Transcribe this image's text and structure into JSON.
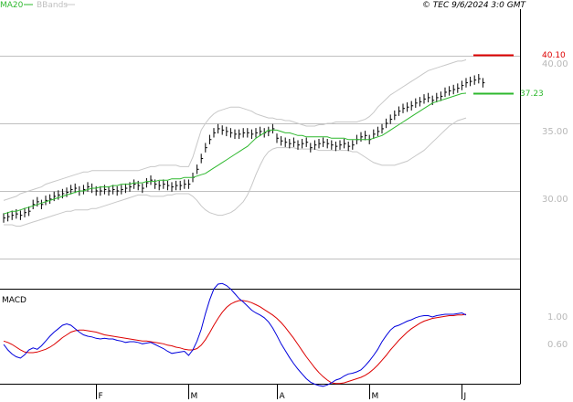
{
  "header": {
    "legend_ma": "MA20",
    "legend_bb": "BBands",
    "stamp": "© TEC 9/6/2024 3:0 GMT"
  },
  "price_labels": {
    "resistance": "40.10",
    "ma_value": "37.23"
  },
  "macd_label": "MACD",
  "colors": {
    "ma": "#2eb82e",
    "bands": "#c8c8c8",
    "resistance": "#dd0000",
    "macd": "#0000dd",
    "signal": "#dd0000",
    "grid": "#c0c0c0"
  },
  "chart_data": [
    {
      "type": "line",
      "title": "",
      "price_axis_ticks": [
        "40.00",
        "35.00",
        "30.00"
      ],
      "ylim": [
        26.0,
        42.4
      ],
      "x_month_labels": [
        {
          "label": "F",
          "bar": 22
        },
        {
          "label": "M",
          "bar": 44
        },
        {
          "label": "A",
          "bar": 65
        },
        {
          "label": "M",
          "bar": 87
        },
        {
          "label": "J",
          "bar": 109
        }
      ],
      "levels": {
        "resistance": 40.1,
        "ma_last": 37.23
      },
      "series": [
        {
          "role": "ma20",
          "name": "MA20",
          "values": [
            28.3,
            28.4,
            28.5,
            28.5,
            28.6,
            28.7,
            28.8,
            28.9,
            29.0,
            29.1,
            29.2,
            29.3,
            29.4,
            29.5,
            29.6,
            29.7,
            29.8,
            29.9,
            30.0,
            30.0,
            30.1,
            30.2,
            30.2,
            30.3,
            30.3,
            30.3,
            30.4,
            30.4,
            30.5,
            30.5,
            30.5,
            30.6,
            30.6,
            30.6,
            30.7,
            30.7,
            30.7,
            30.8,
            30.8,
            30.8,
            30.9,
            30.9,
            30.9,
            31.0,
            31.0,
            31.0,
            31.1,
            31.2,
            31.3,
            31.5,
            31.7,
            31.9,
            32.1,
            32.3,
            32.5,
            32.7,
            32.9,
            33.1,
            33.3,
            33.6,
            33.9,
            34.1,
            34.3,
            34.5,
            34.5,
            34.5,
            34.4,
            34.3,
            34.3,
            34.2,
            34.1,
            34.1,
            34.0,
            34.0,
            34.0,
            34.0,
            34.0,
            34.0,
            33.9,
            33.9,
            33.9,
            33.9,
            33.8,
            33.8,
            33.8,
            33.8,
            33.8,
            33.8,
            33.9,
            34.0,
            34.1,
            34.3,
            34.5,
            34.7,
            34.9,
            35.1,
            35.3,
            35.5,
            35.7,
            35.9,
            36.1,
            36.3,
            36.5,
            36.6,
            36.7,
            36.8,
            36.9,
            37.0,
            37.1,
            37.2,
            37.23
          ]
        },
        {
          "role": "band_upper",
          "name": "BBands",
          "values": [
            29.3,
            29.4,
            29.5,
            29.6,
            29.8,
            29.9,
            30.0,
            30.1,
            30.2,
            30.3,
            30.5,
            30.6,
            30.7,
            30.8,
            30.9,
            31.0,
            31.1,
            31.2,
            31.3,
            31.4,
            31.4,
            31.5,
            31.5,
            31.5,
            31.5,
            31.5,
            31.5,
            31.5,
            31.5,
            31.5,
            31.5,
            31.5,
            31.5,
            31.6,
            31.7,
            31.8,
            31.8,
            31.9,
            31.9,
            31.9,
            31.9,
            31.9,
            31.8,
            31.8,
            31.8,
            32.5,
            33.5,
            34.5,
            35.0,
            35.4,
            35.7,
            35.9,
            36.0,
            36.1,
            36.2,
            36.2,
            36.2,
            36.1,
            36.0,
            35.9,
            35.7,
            35.6,
            35.5,
            35.4,
            35.4,
            35.3,
            35.3,
            35.2,
            35.2,
            35.1,
            35.0,
            34.9,
            34.8,
            34.8,
            34.8,
            34.9,
            34.9,
            35.0,
            35.0,
            35.1,
            35.1,
            35.1,
            35.1,
            35.1,
            35.1,
            35.2,
            35.3,
            35.5,
            35.8,
            36.2,
            36.5,
            36.8,
            37.1,
            37.3,
            37.5,
            37.7,
            37.9,
            38.1,
            38.3,
            38.5,
            38.7,
            38.9,
            39.0,
            39.1,
            39.2,
            39.3,
            39.4,
            39.5,
            39.6,
            39.6,
            39.7
          ]
        },
        {
          "role": "band_lower",
          "name": "BBands",
          "values": [
            27.5,
            27.5,
            27.5,
            27.4,
            27.4,
            27.5,
            27.6,
            27.7,
            27.8,
            27.9,
            28.0,
            28.1,
            28.2,
            28.3,
            28.4,
            28.5,
            28.5,
            28.6,
            28.6,
            28.6,
            28.6,
            28.7,
            28.7,
            28.8,
            28.9,
            29.0,
            29.1,
            29.2,
            29.3,
            29.4,
            29.5,
            29.6,
            29.7,
            29.7,
            29.7,
            29.6,
            29.6,
            29.6,
            29.6,
            29.7,
            29.7,
            29.8,
            29.8,
            29.8,
            29.8,
            29.6,
            29.3,
            28.9,
            28.6,
            28.4,
            28.3,
            28.2,
            28.2,
            28.3,
            28.4,
            28.6,
            28.9,
            29.2,
            29.7,
            30.4,
            31.2,
            31.9,
            32.5,
            32.9,
            33.1,
            33.2,
            33.2,
            33.2,
            33.2,
            33.2,
            33.1,
            33.1,
            33.1,
            33.1,
            33.1,
            33.0,
            33.0,
            33.0,
            33.0,
            33.0,
            33.0,
            33.0,
            33.0,
            32.9,
            32.9,
            32.7,
            32.5,
            32.3,
            32.1,
            32.0,
            31.9,
            31.9,
            31.9,
            31.9,
            32.0,
            32.1,
            32.2,
            32.4,
            32.6,
            32.8,
            33.0,
            33.3,
            33.6,
            33.9,
            34.2,
            34.5,
            34.8,
            35.0,
            35.2,
            35.3,
            35.4
          ]
        },
        {
          "role": "close",
          "name": "",
          "values": [
            28.0,
            28.1,
            28.2,
            28.3,
            28.2,
            28.4,
            28.5,
            29.0,
            29.2,
            29.0,
            29.3,
            29.4,
            29.6,
            29.7,
            29.8,
            29.9,
            30.1,
            30.2,
            30.0,
            30.1,
            30.3,
            30.2,
            30.0,
            30.0,
            30.1,
            30.0,
            30.1,
            30.0,
            30.1,
            30.2,
            30.3,
            30.5,
            30.4,
            30.2,
            30.6,
            30.8,
            30.5,
            30.4,
            30.5,
            30.4,
            30.3,
            30.4,
            30.4,
            30.5,
            30.5,
            31.0,
            31.6,
            32.4,
            33.2,
            33.8,
            34.3,
            34.6,
            34.5,
            34.4,
            34.3,
            34.2,
            34.2,
            34.3,
            34.3,
            34.2,
            34.3,
            34.4,
            34.3,
            34.4,
            34.6,
            33.9,
            33.7,
            33.6,
            33.5,
            33.6,
            33.4,
            33.5,
            33.6,
            33.2,
            33.4,
            33.5,
            33.6,
            33.5,
            33.4,
            33.3,
            33.4,
            33.5,
            33.3,
            33.4,
            33.8,
            34.0,
            34.1,
            33.8,
            34.2,
            34.4,
            34.6,
            35.0,
            35.3,
            35.6,
            35.9,
            36.1,
            36.2,
            36.3,
            36.5,
            36.6,
            36.8,
            36.9,
            36.7,
            36.9,
            37.0,
            37.3,
            37.4,
            37.5,
            37.6,
            37.8,
            38.0,
            38.1,
            38.2,
            38.3,
            38.0
          ]
        }
      ]
    },
    {
      "type": "line",
      "title": "MACD",
      "axis_ticks": [
        "1.00",
        "0.60"
      ],
      "ylim": [
        -0.15,
        1.6
      ],
      "series": [
        {
          "role": "macd",
          "name": "",
          "values": [
            0.6,
            0.52,
            0.46,
            0.42,
            0.4,
            0.45,
            0.52,
            0.55,
            0.53,
            0.58,
            0.65,
            0.72,
            0.78,
            0.83,
            0.88,
            0.9,
            0.88,
            0.83,
            0.78,
            0.74,
            0.72,
            0.71,
            0.69,
            0.68,
            0.69,
            0.68,
            0.68,
            0.66,
            0.65,
            0.63,
            0.64,
            0.64,
            0.63,
            0.61,
            0.62,
            0.63,
            0.6,
            0.57,
            0.54,
            0.5,
            0.47,
            0.48,
            0.49,
            0.5,
            0.44,
            0.52,
            0.65,
            0.82,
            1.05,
            1.25,
            1.41,
            1.48,
            1.49,
            1.46,
            1.41,
            1.34,
            1.27,
            1.22,
            1.16,
            1.1,
            1.06,
            1.03,
            0.99,
            0.93,
            0.84,
            0.73,
            0.61,
            0.51,
            0.41,
            0.32,
            0.24,
            0.17,
            0.1,
            0.05,
            0.02,
            0.0,
            -0.01,
            0.01,
            0.04,
            0.08,
            0.1,
            0.14,
            0.17,
            0.18,
            0.2,
            0.23,
            0.29,
            0.36,
            0.44,
            0.53,
            0.64,
            0.73,
            0.81,
            0.86,
            0.88,
            0.91,
            0.94,
            0.96,
            0.99,
            1.01,
            1.02,
            1.02,
            1.0,
            1.02,
            1.03,
            1.04,
            1.04,
            1.04,
            1.05,
            1.06,
            1.03
          ]
        },
        {
          "role": "signal",
          "name": "",
          "values": [
            0.65,
            0.63,
            0.6,
            0.56,
            0.52,
            0.49,
            0.48,
            0.48,
            0.49,
            0.51,
            0.53,
            0.56,
            0.6,
            0.65,
            0.7,
            0.74,
            0.78,
            0.8,
            0.81,
            0.81,
            0.8,
            0.79,
            0.78,
            0.76,
            0.74,
            0.73,
            0.72,
            0.71,
            0.7,
            0.69,
            0.68,
            0.67,
            0.66,
            0.65,
            0.65,
            0.64,
            0.63,
            0.62,
            0.61,
            0.59,
            0.58,
            0.56,
            0.55,
            0.53,
            0.52,
            0.52,
            0.54,
            0.59,
            0.67,
            0.77,
            0.88,
            0.98,
            1.07,
            1.14,
            1.19,
            1.22,
            1.24,
            1.24,
            1.23,
            1.21,
            1.18,
            1.15,
            1.11,
            1.07,
            1.03,
            0.98,
            0.92,
            0.85,
            0.77,
            0.69,
            0.6,
            0.51,
            0.42,
            0.34,
            0.26,
            0.19,
            0.13,
            0.08,
            0.04,
            0.03,
            0.03,
            0.04,
            0.06,
            0.08,
            0.1,
            0.12,
            0.15,
            0.19,
            0.24,
            0.3,
            0.37,
            0.44,
            0.52,
            0.59,
            0.66,
            0.72,
            0.78,
            0.83,
            0.87,
            0.91,
            0.94,
            0.96,
            0.98,
            0.99,
            1.0,
            1.01,
            1.02,
            1.02,
            1.03,
            1.03,
            1.04
          ]
        }
      ]
    }
  ]
}
